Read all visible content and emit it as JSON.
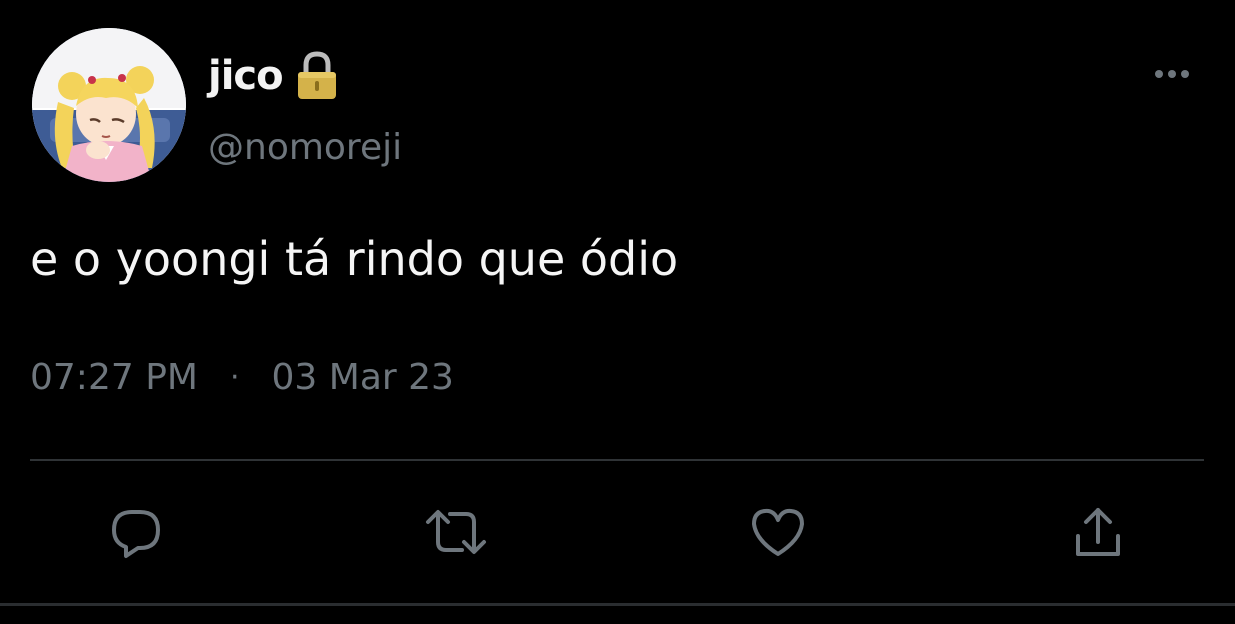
{
  "author": {
    "display_name": "jico",
    "handle": "@nomoreji",
    "avatar_icon": "sailor-moon-avatar",
    "protected_icon": "lock-icon"
  },
  "tweet": {
    "text": "e o yoongi tá rindo que ódio",
    "time": "07:27 PM",
    "separator": "·",
    "date": "03 Mar 23"
  },
  "actions": [
    {
      "icon": "reply-icon"
    },
    {
      "icon": "retweet-icon"
    },
    {
      "icon": "like-icon"
    },
    {
      "icon": "share-icon"
    }
  ],
  "menu": {
    "icon": "more-options-icon"
  },
  "colors": {
    "background": "#000000",
    "primary_text": "#e7e9ea",
    "secondary_text": "#6e767d",
    "divider": "#2f3336",
    "lock": "#d4b24a"
  }
}
